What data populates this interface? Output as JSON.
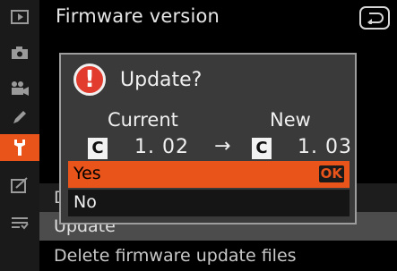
{
  "header": {
    "title": "Firmware version"
  },
  "sidebar": {
    "items": [
      {
        "icon": "playback-icon",
        "active": false
      },
      {
        "icon": "camera-icon",
        "active": false
      },
      {
        "icon": "movie-camera-icon",
        "active": false
      },
      {
        "icon": "pencil-icon",
        "active": false
      },
      {
        "icon": "wrench-icon",
        "active": true
      },
      {
        "icon": "retouch-icon",
        "active": false
      },
      {
        "icon": "my-menu-icon",
        "active": false
      }
    ]
  },
  "menu": {
    "row_partial": "D",
    "row_update": "Update",
    "row_delete": "Delete firmware update files"
  },
  "dialog": {
    "question": "Update?",
    "current_label": "Current",
    "new_label": "New",
    "current_slot": "C",
    "current_version": "1. 02",
    "arrow": "→",
    "new_slot": "C",
    "new_version": "1. 03",
    "yes_label": "Yes",
    "ok_badge": "OK",
    "no_label": "No"
  },
  "colors": {
    "accent": "#e8541a",
    "warning": "#e23c2f"
  }
}
